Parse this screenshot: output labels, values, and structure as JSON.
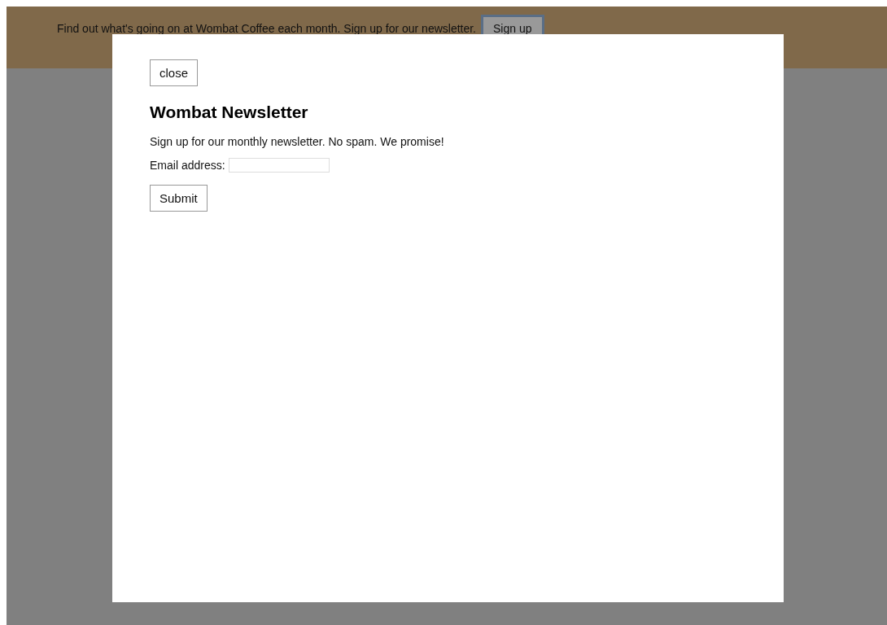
{
  "banner": {
    "text": "Find out what's going on at Wombat Coffee each month. Sign up for our newsletter.",
    "button": "Sign up"
  },
  "dialog": {
    "close_button": "close",
    "title": "Wombat Newsletter",
    "description": "Sign up for our monthly newsletter. No spam. We promise!",
    "email_label": "Email address:",
    "submit_button": "Submit"
  }
}
